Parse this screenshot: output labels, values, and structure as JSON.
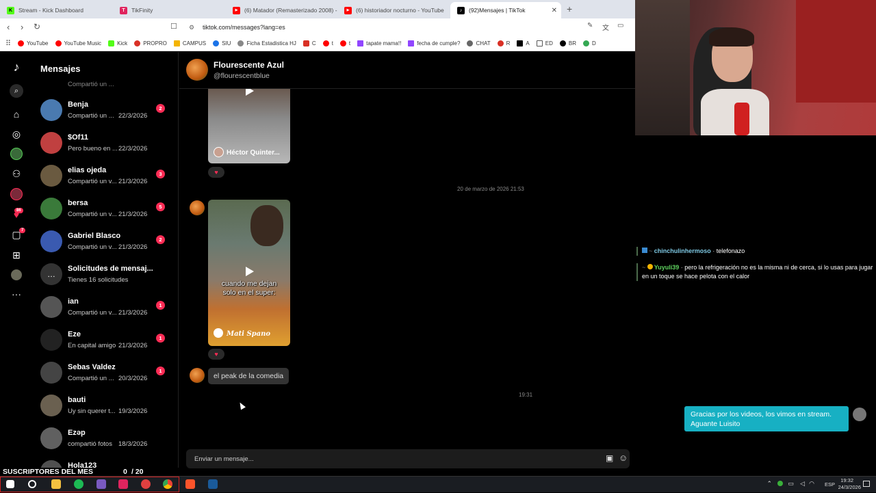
{
  "browser": {
    "tabs": [
      {
        "label": "Stream - Kick Dashboard",
        "color": "#53fc18",
        "glyph": "K"
      },
      {
        "label": "TikFinity",
        "color": "#e0245e",
        "glyph": "T"
      },
      {
        "label": "(6) Matador (Remasterizado 2008) - Y",
        "color": "#ff0000",
        "glyph": "▶"
      },
      {
        "label": "(6) historiador nocturno - YouTube",
        "color": "#ff0000",
        "glyph": "▶"
      },
      {
        "label": "(92)Mensajes | TikTok",
        "color": "#000000",
        "glyph": "♪"
      }
    ],
    "url": "tiktok.com/messages?lang=es",
    "bookmarks": [
      {
        "label": "YouTube",
        "color": "#ff0000"
      },
      {
        "label": "YouTube Music",
        "color": "#ff0000"
      },
      {
        "label": "Kick",
        "color": "#53fc18"
      },
      {
        "label": "PROPRO",
        "color": "#d93025"
      },
      {
        "label": "CAMPUS",
        "color": "#f4b400"
      },
      {
        "label": "SIU",
        "color": "#1a73e8"
      },
      {
        "label": "Ficha Estadistica HJ",
        "color": "#888888"
      },
      {
        "label": "C",
        "color": "#d93025"
      },
      {
        "label": "t",
        "color": "#ff0000"
      },
      {
        "label": "t",
        "color": "#ff0000"
      },
      {
        "label": "tapate mama!!",
        "color": "#9146ff"
      },
      {
        "label": "fecha de cumple?",
        "color": "#9146ff"
      },
      {
        "label": "CHAT",
        "color": "#666666"
      },
      {
        "label": "R",
        "color": "#d93025"
      },
      {
        "label": "A",
        "color": "#000000"
      },
      {
        "label": "ED",
        "color": "#888888"
      },
      {
        "label": "BR",
        "color": "#000000"
      },
      {
        "label": "D",
        "color": "#34a853"
      }
    ]
  },
  "sidebar": {
    "profile_badge": "86",
    "inbox_badge": "7"
  },
  "messages": {
    "title": "Mensajes",
    "partial_preview": "Compartió un ...",
    "conversations": [
      {
        "name": "Benja",
        "preview": "Compartió un ...",
        "date": "22/3/2026",
        "count": "2",
        "color": "#4a7ab0"
      },
      {
        "name": "$Of11",
        "preview": "Pero bueno en ...",
        "date": "22/3/2026",
        "count": "",
        "color": "#c04040"
      },
      {
        "name": "elias ojeda",
        "preview": "Compartió un v...",
        "date": "21/3/2026",
        "count": "3",
        "color": "#6a5a40"
      },
      {
        "name": "bersa",
        "preview": "Compartió un v...",
        "date": "21/3/2026",
        "count": "5",
        "color": "#3a7a3a"
      },
      {
        "name": "Gabriel Blasco",
        "preview": "Compartió un v...",
        "date": "21/3/2026",
        "count": "2",
        "color": "#3a5ab0"
      },
      {
        "name": "Solicitudes de mensaj...",
        "preview": "Tienes 16 solicitudes",
        "date": "",
        "count": "",
        "color": "#333333"
      },
      {
        "name": "ian",
        "preview": "Compartió un v...",
        "date": "21/3/2026",
        "count": "1",
        "color": "#555555"
      },
      {
        "name": "Eze",
        "preview": "En capital amigo",
        "date": "21/3/2026",
        "count": "1",
        "color": "#222222"
      },
      {
        "name": "Sebas Valdez",
        "preview": "Compartió un ...",
        "date": "20/3/2026",
        "count": "1",
        "color": "#444444"
      },
      {
        "name": "bauti",
        "preview": "Uy sin querer t...",
        "date": "19/3/2026",
        "count": "",
        "color": "#6a6050"
      },
      {
        "name": "Ezəp",
        "preview": "compartió fotos",
        "date": "18/3/2026",
        "count": "",
        "color": "#606060"
      },
      {
        "name": "Hola123",
        "preview": "",
        "date": "",
        "count": "",
        "color": "#505050"
      }
    ]
  },
  "chat": {
    "name": "Flourescente Azul",
    "handle": "@flourescentblue",
    "video1_caption": "Héctor Quinter...",
    "timestamp1": "20 de marzo de 2026 21:53",
    "video2_caption": "cuando me dejan solo en el super:",
    "video2_watermark": "Mati Spano",
    "text_message": "el peak de la comedia",
    "timestamp2": "19:31",
    "input_placeholder": "Enviar un mensaje..."
  },
  "overlay": {
    "chat_lines": [
      {
        "user": "chinchulinhermoso",
        "text": "telefonazo",
        "user_color": "#7ec8e3"
      },
      {
        "user": "Yuyuli39",
        "text": "pero la refrigeración no es la misma ni de cerca, si lo usas para jugar en un toque se hace pelota con el calor",
        "user_color": "#5fd35f"
      }
    ],
    "sent_message": "Gracias por los videos, los vimos en stream. Aguante Luisito",
    "subs_label": "SUSCRIPTORES DEL MES",
    "subs_count": "0",
    "subs_goal": "/ 20"
  },
  "taskbar": {
    "lang": "ESP",
    "time": "19:32",
    "date": "24/3/2026"
  }
}
